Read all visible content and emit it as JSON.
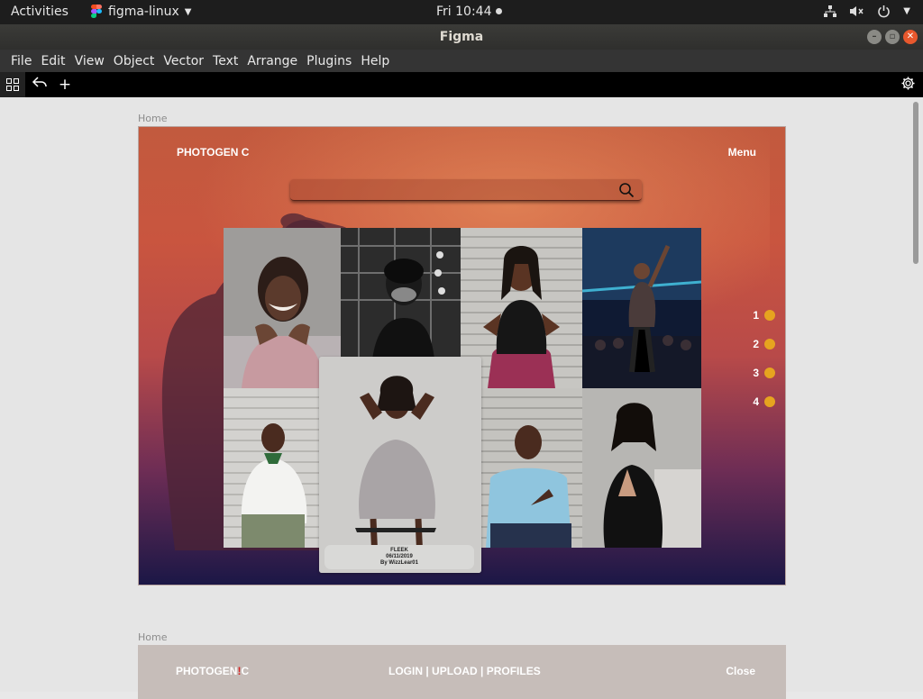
{
  "topbar": {
    "activities": "Activities",
    "app_name": "figma-linux",
    "app_dropdown_icon": "triangle-down-icon",
    "clock": "Fri 10:44",
    "tray_icons": [
      "network-icon",
      "volume-muted-icon",
      "power-icon",
      "triangle-down-icon"
    ]
  },
  "window": {
    "title": "Figma",
    "buttons": [
      "minimize",
      "maximize",
      "close"
    ]
  },
  "menubar": {
    "items": [
      "File",
      "Edit",
      "View",
      "Object",
      "Vector",
      "Text",
      "Arrange",
      "Plugins",
      "Help"
    ]
  },
  "toolbar": {
    "icons": [
      "grid-icon",
      "back-arrow-icon",
      "plus-icon",
      "settings-gear-icon"
    ],
    "plus": "+"
  },
  "canvas": {
    "frame1": {
      "label": "Home",
      "brand": "PHOTOGEN C",
      "menu": "Menu",
      "search_icon": "search-icon",
      "pager": [
        "1",
        "2",
        "3",
        "4"
      ],
      "pager_color": "#e6a41f",
      "featured_caption": {
        "title": "FLEEK",
        "date": "06/11/2019",
        "credit": "By WizzLear01"
      }
    },
    "frame2": {
      "label": "Home",
      "brand_pre": "PHOTOGEN",
      "brand_mark": "!",
      "brand_post": "C",
      "nav": "LOGIN | UPLOAD | PROFILES",
      "close": "Close"
    }
  },
  "colors": {
    "hero_top": "#c25a3e",
    "hero_bottom": "#1b1746",
    "accent_dot": "#e6a41f"
  }
}
